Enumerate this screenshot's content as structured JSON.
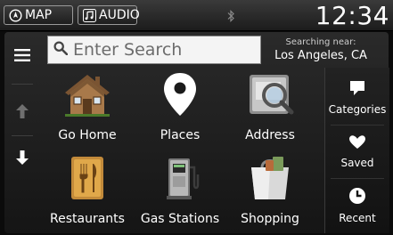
{
  "status_bar": {
    "map_label": "MAP",
    "audio_label": "AUDIO",
    "clock": "12:34"
  },
  "search": {
    "placeholder": "Enter Search",
    "near_label": "Searching near:",
    "near_location": "Los Angeles, CA"
  },
  "categories": [
    {
      "label": "Go Home",
      "icon": "house-icon"
    },
    {
      "label": "Places",
      "icon": "map-pin-icon"
    },
    {
      "label": "Address",
      "icon": "address-book-icon"
    },
    {
      "label": "Restaurants",
      "icon": "fork-knife-icon"
    },
    {
      "label": "Gas Stations",
      "icon": "fuel-pump-icon"
    },
    {
      "label": "Shopping",
      "icon": "shopping-bag-icon"
    }
  ],
  "right_menu": [
    {
      "label": "Categories",
      "icon": "flag-icon"
    },
    {
      "label": "Saved",
      "icon": "heart-icon"
    },
    {
      "label": "Recent",
      "icon": "clock-icon"
    }
  ]
}
